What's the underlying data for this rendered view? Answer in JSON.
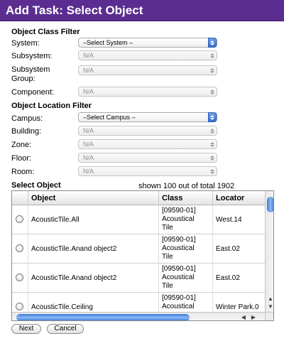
{
  "dialog": {
    "title": "Add Task: Select Object"
  },
  "class_filter": {
    "heading": "Object Class Filter",
    "fields": [
      {
        "label": "System:",
        "value": "–Select System –",
        "enabled": true
      },
      {
        "label": "Subsystem:",
        "value": "N/A",
        "enabled": false
      },
      {
        "label": "Subsystem\nGroup:",
        "value": "N/A",
        "enabled": false
      },
      {
        "label": "Component:",
        "value": "N/A",
        "enabled": false
      }
    ]
  },
  "location_filter": {
    "heading": "Object Location Filter",
    "fields": [
      {
        "label": "Campus:",
        "value": "–Select Campus –",
        "enabled": true
      },
      {
        "label": "Building:",
        "value": "N/A",
        "enabled": false
      },
      {
        "label": "Zone:",
        "value": "N/A",
        "enabled": false
      },
      {
        "label": "Floor:",
        "value": "N/A",
        "enabled": false
      },
      {
        "label": "Room:",
        "value": "N/A",
        "enabled": false
      }
    ]
  },
  "select_object": {
    "heading": "Select Object",
    "shown_text": "shown 100 out of total 1902",
    "columns": [
      "Object",
      "Class",
      "Locator"
    ],
    "rows": [
      {
        "object": "AcousticTile.All",
        "class": "[09590-01]\nAcoustical\nTile",
        "locator": "West.14"
      },
      {
        "object": "AcousticTile.Anand object2",
        "class": "[09590-01]\nAcoustical\nTile",
        "locator": "East.02"
      },
      {
        "object": "AcousticTile.Anand object2",
        "class": "[09590-01]\nAcoustical\nTile",
        "locator": "East.02"
      },
      {
        "object": "AcousticTile.Ceiling",
        "class": "[09590-01]\nAcoustical",
        "locator": "Winter Park.0"
      }
    ]
  },
  "buttons": {
    "next": "Next",
    "cancel": "Cancel"
  },
  "icons": {
    "scroll_up": "▲",
    "scroll_down": "▼",
    "scroll_left": "◀",
    "scroll_right": "▶"
  },
  "colors": {
    "titlebar": "#5b2d90",
    "accent": "#3c78d8"
  }
}
